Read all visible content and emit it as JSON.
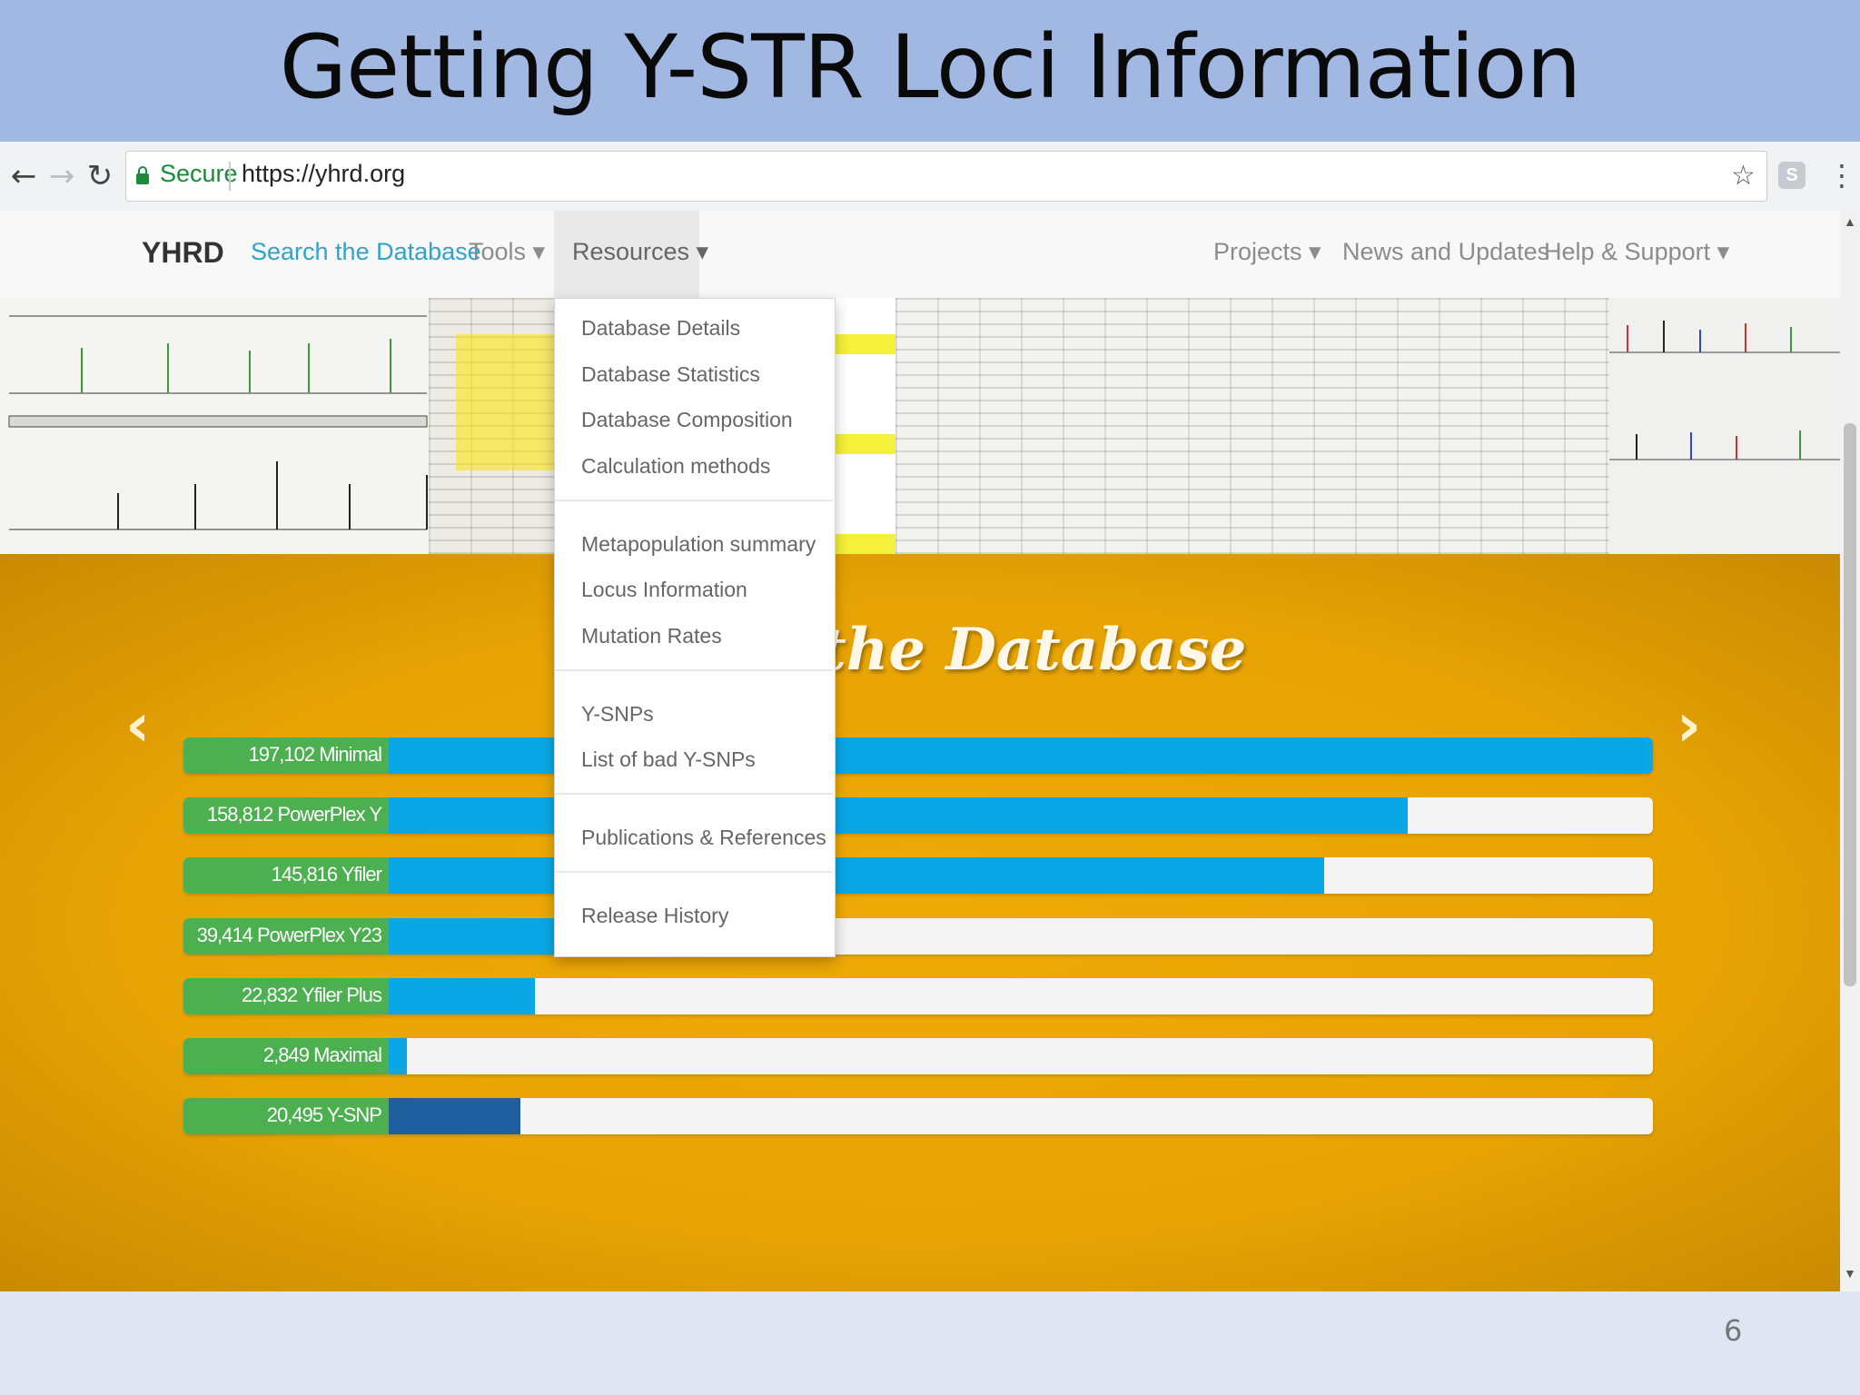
{
  "slide": {
    "title": "Getting Y-STR Loci Information",
    "page_number": "6"
  },
  "browser": {
    "secure_label": "Secure",
    "url": "https://yhrd.org"
  },
  "navbar": {
    "brand": "YHRD",
    "items": [
      {
        "label": "Search the Database"
      },
      {
        "label": "Tools ▾"
      },
      {
        "label": "Resources ▾"
      },
      {
        "label": "Projects ▾"
      },
      {
        "label": "News and Updates"
      },
      {
        "label": "Help & Support ▾"
      }
    ],
    "active_color": "#2fa3c9"
  },
  "dropdown": {
    "groups": [
      [
        "Database Details",
        "Database Statistics",
        "Database Composition",
        "Calculation methods"
      ],
      [
        "Metapopulation summary",
        "Locus Information",
        "Mutation Rates"
      ],
      [
        "Y-SNPs",
        "List of bad Y-SNPs"
      ],
      [
        "Publications & References"
      ],
      [
        "Release History"
      ]
    ]
  },
  "stats": {
    "title": "ate of the Database",
    "bars": [
      {
        "label": "197,102 Minimal",
        "value": 197102,
        "fill_fraction": 1.0,
        "color": "#0aa7e6"
      },
      {
        "label": "158,812 PowerPlex Y",
        "value": 158812,
        "fill_fraction": 0.8057,
        "color": "#0aa7e6"
      },
      {
        "label": "145,816 Yfiler",
        "value": 145816,
        "fill_fraction": 0.7398,
        "color": "#0aa7e6"
      },
      {
        "label": "39,414 PowerPlex Y23",
        "value": 39414,
        "fill_fraction": 0.2,
        "color": "#0aa7e6"
      },
      {
        "label": "22,832 Yfiler Plus",
        "value": 22832,
        "fill_fraction": 0.1158,
        "color": "#0aa7e6"
      },
      {
        "label": "2,849 Maximal",
        "value": 2849,
        "fill_fraction": 0.0145,
        "color": "#0aa7e6"
      },
      {
        "label": "20,495 Y-SNP",
        "value": 20495,
        "fill_fraction": 0.104,
        "color": "#1f5fa0"
      }
    ],
    "label_color": "#4caf50"
  },
  "icons": {
    "back": "back-arrow-icon",
    "forward": "forward-arrow-icon",
    "reload": "reload-icon",
    "lock": "lock-icon",
    "star": "star-icon",
    "extension": "skype-extension-icon",
    "menu": "kebab-menu-icon",
    "carousel_prev": "chevron-left-icon",
    "carousel_next": "chevron-right-icon"
  }
}
